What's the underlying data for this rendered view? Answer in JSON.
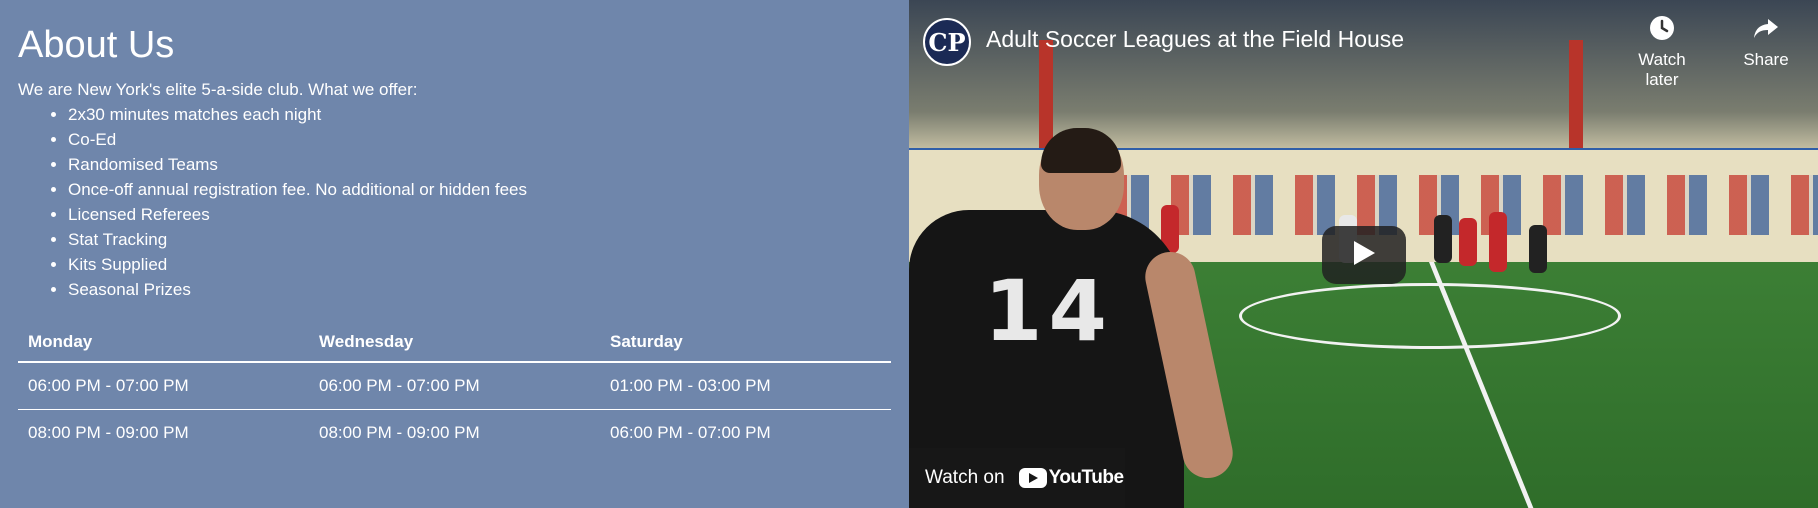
{
  "about": {
    "title": "About Us",
    "intro": "We are New York's elite 5-a-side club. What we offer:",
    "offers": [
      "2x30 minutes matches each night",
      "Co-Ed",
      "Randomised Teams",
      "Once-off annual registration fee. No additional or hidden fees",
      "Licensed Referees",
      "Stat Tracking",
      "Kits Supplied",
      "Seasonal Prizes"
    ]
  },
  "schedule": {
    "headers": [
      "Monday",
      "Wednesday",
      "Saturday"
    ],
    "rows": [
      [
        "06:00 PM - 07:00 PM",
        "06:00 PM - 07:00 PM",
        "01:00 PM - 03:00 PM"
      ],
      [
        "08:00 PM - 09:00 PM",
        "08:00 PM - 09:00 PM",
        "06:00 PM - 07:00 PM"
      ]
    ]
  },
  "video": {
    "channel_logo": "CP",
    "title": "Adult Soccer Leagues at the Field House",
    "watch_later_label": "Watch later",
    "share_label": "Share",
    "watch_on_label": "Watch on",
    "youtube_label": "YouTube",
    "jersey_number": "14",
    "icons": {
      "watch_later": "clock-icon",
      "share": "share-arrow-icon",
      "play": "play-icon",
      "youtube": "youtube-logo-icon"
    }
  },
  "colors": {
    "panel_bg": "#6f86ab",
    "text": "#ffffff",
    "play_button_bg": "#212121"
  }
}
